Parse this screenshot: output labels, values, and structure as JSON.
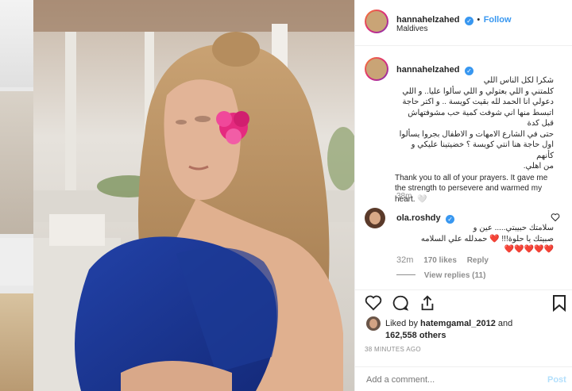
{
  "post": {
    "username": "hannahelzahed",
    "follow_label": "Follow",
    "follow_dot": "•",
    "location": "Maldives"
  },
  "caption": {
    "username": "hannahelzahed",
    "arabic_lines": [
      "شكرا لكل الناس اللي",
      "كلمتني و اللي بعتولي و اللي سألوا عليا.. و اللي",
      "دعولي انا الحمد لله بقيت كويسة ..  و اكتر حاجة",
      "اتبسط منها اني شوفت كمية حب مشوفتهاش قبل كدة",
      "حتى في الشارع الامهات و الاطفال بجروا يسألوا",
      "اول حاجة هنا انتي كويسة ؟ خضيتينا عليكي و كأنهم",
      "من اهلي."
    ],
    "english": "Thank you to all of your prayers. It gave me the strength to persevere and warmed my heart. 🤍",
    "time": "38m"
  },
  "comment": {
    "username": "ola.roshdy",
    "arabic_lines": [
      "سلامتك حبيبتي..... عين و",
      "صبيتك يا حلوة!!! ❤️ حمدلله علي السلامه",
      "❤️❤️❤️❤️❤️"
    ],
    "time": "32m",
    "likes": "170 likes",
    "reply": "Reply",
    "view_replies": "View replies (11)"
  },
  "likes": {
    "prefix": "Liked by",
    "user": "hatemgamal_2012",
    "and": "and",
    "others": "162,558 others",
    "timestamp": "38 MINUTES AGO"
  },
  "add_comment": {
    "placeholder": "Add a comment...",
    "post_label": "Post"
  },
  "colors": {
    "link": "#3897f0",
    "muted": "#8e8e8e",
    "text": "#262626",
    "verified": "#3897f0"
  },
  "icons": [
    "heart-icon",
    "comment-icon",
    "share-icon",
    "bookmark-icon",
    "verified-badge-icon"
  ]
}
